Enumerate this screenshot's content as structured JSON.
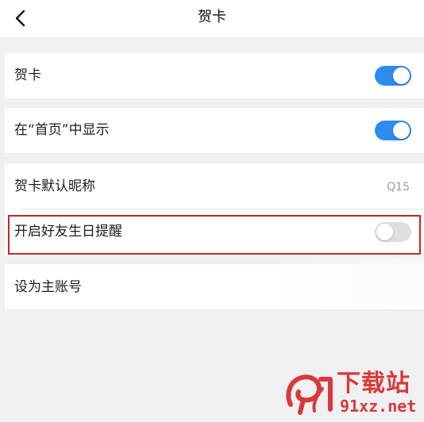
{
  "header": {
    "title": "贺卡",
    "back_icon": "chevron-left-icon"
  },
  "settings": {
    "greeting_card": {
      "label": "贺卡",
      "toggle_on": true
    },
    "show_on_home": {
      "label": "在“首页”中显示",
      "toggle_on": true
    },
    "default_nickname": {
      "label": "贺卡默认昵称",
      "value": "Q15"
    },
    "birthday_reminder": {
      "label": "开启好友生日提醒",
      "toggle_on": false
    },
    "set_primary_account": {
      "label": "设为主账号"
    }
  },
  "colors": {
    "toggle_on": "#2d8cf0",
    "toggle_off": "#dedee0",
    "highlight": "#c0272d",
    "background": "#f0f0f2"
  },
  "watermark": {
    "text_cn": "下载站",
    "text_en": "91xz.net"
  }
}
